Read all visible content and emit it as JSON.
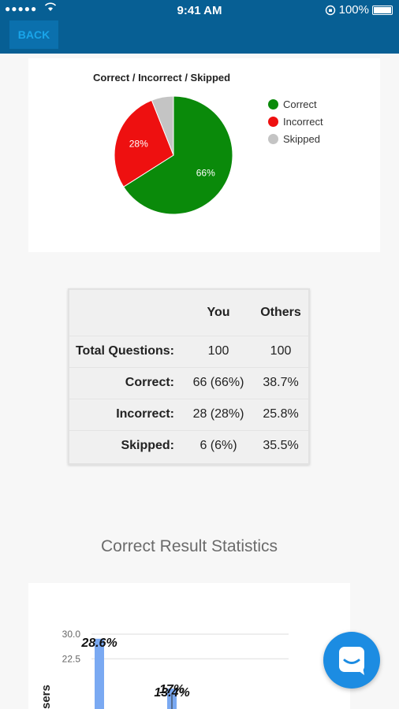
{
  "status_bar": {
    "signal_dots": "●●●●●",
    "time": "9:41 AM",
    "battery_percent": "100%"
  },
  "nav": {
    "back_label": "BACK"
  },
  "colors": {
    "correct": "#0a8a0a",
    "incorrect": "#ee1010",
    "skipped": "#c4c4c4",
    "accent": "#075f94",
    "bar": "#7aa9f2"
  },
  "pie_chart": {
    "title": "Correct / Incorrect / Skipped",
    "legend": [
      "Correct",
      "Incorrect",
      "Skipped"
    ]
  },
  "table": {
    "headers": [
      "",
      "You",
      "Others"
    ],
    "rows": [
      {
        "label": "Total Questions:",
        "you": "100",
        "others": "100"
      },
      {
        "label": "Correct:",
        "you": "66 (66%)",
        "others": "38.7%"
      },
      {
        "label": "Incorrect:",
        "you": "28 (28%)",
        "others": "25.8%"
      },
      {
        "label": "Skipped:",
        "you": "6 (6%)",
        "others": "35.5%"
      }
    ]
  },
  "section_heading": "Correct Result Statistics",
  "chart_data": [
    {
      "type": "pie",
      "title": "Correct / Incorrect / Skipped",
      "labels": [
        "Correct",
        "Incorrect",
        "Skipped"
      ],
      "values": [
        66,
        28,
        6
      ],
      "slice_labels": [
        "66%",
        "28%",
        ""
      ],
      "colors": [
        "#0a8a0a",
        "#ee1010",
        "#c4c4c4"
      ],
      "legend_position": "right"
    },
    {
      "type": "bar",
      "ylabel": "sers",
      "y_ticks": [
        "30.0",
        "22.5"
      ],
      "values": [
        28.6,
        13.4
      ],
      "data_labels": [
        "28.6%",
        "13.4%"
      ],
      "annotation": "17%",
      "ylim": [
        0,
        30
      ]
    }
  ]
}
